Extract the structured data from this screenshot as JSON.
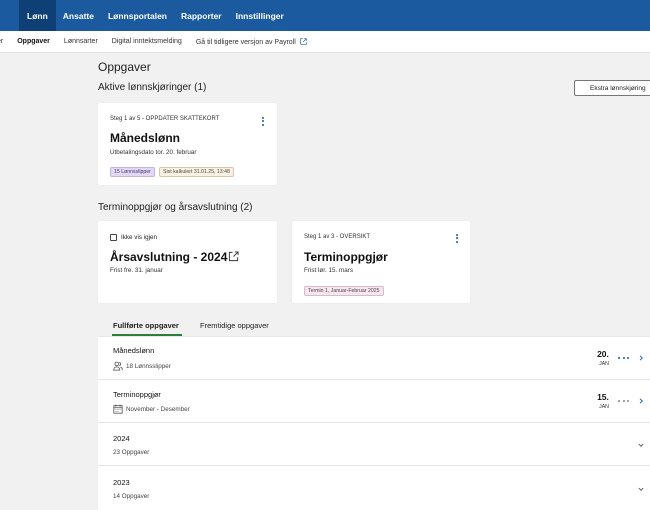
{
  "topnav": {
    "items": [
      "Lønn",
      "Ansatte",
      "Lønnsportalen",
      "Rapporter",
      "Innstillinger"
    ],
    "active": "Lønn",
    "colors": {
      "bar": "#1b5a9e",
      "active": "#0e3f75"
    }
  },
  "subnav": {
    "items": [
      "er",
      "Oppgaver",
      "Lønnsarter",
      "Digital inntektsmelding",
      "Gå til tidligere versjon av Payroll"
    ],
    "active": "Oppgaver",
    "external_icon": "external-link-icon"
  },
  "page": {
    "title": "Oppgaver",
    "active_runs": {
      "heading": "Aktive lønnskjøringer (1)",
      "extra_button": "Ekstra lønnskjøring",
      "card": {
        "step": "Steg 1 av 5 - OPPDATER SKATTEKORT",
        "title": "Månedslønn",
        "subtitle": "Utbetalingsdato tor. 20. februar",
        "badges": [
          "15 Lønnsslipper",
          "Sist kalkulert 31.01.25, 13:48"
        ]
      }
    },
    "terms": {
      "heading": "Terminoppgjør og årsavslutning (2)",
      "card1": {
        "checkbox_label": "Ikke vis igjen",
        "title": "Årsavslutning - 2024",
        "subtitle": "Frist fre. 31. januar"
      },
      "card2": {
        "step": "Steg 1 av 3 - OVERSIKT",
        "title": "Terminoppgjør",
        "subtitle": "Frist lør. 15. mars",
        "badge": "Termin 1, Januar-Februar 2025"
      }
    },
    "tabs": [
      "Fullførte oppgaver",
      "Fremtidige oppgaver"
    ],
    "active_tab": "Fullførte oppgaver",
    "list": [
      {
        "title": "Månedslønn",
        "sub": "18 Lønnsslipper",
        "icon": "people-icon",
        "day": "20.",
        "month": "JAN"
      },
      {
        "title": "Terminoppgjør",
        "sub": "November - Desember",
        "icon": "calendar-icon",
        "day": "15.",
        "month": "JAN"
      },
      {
        "title": "2024",
        "sub": "23 Oppgaver"
      },
      {
        "title": "2023",
        "sub": "14 Oppgaver"
      }
    ]
  }
}
